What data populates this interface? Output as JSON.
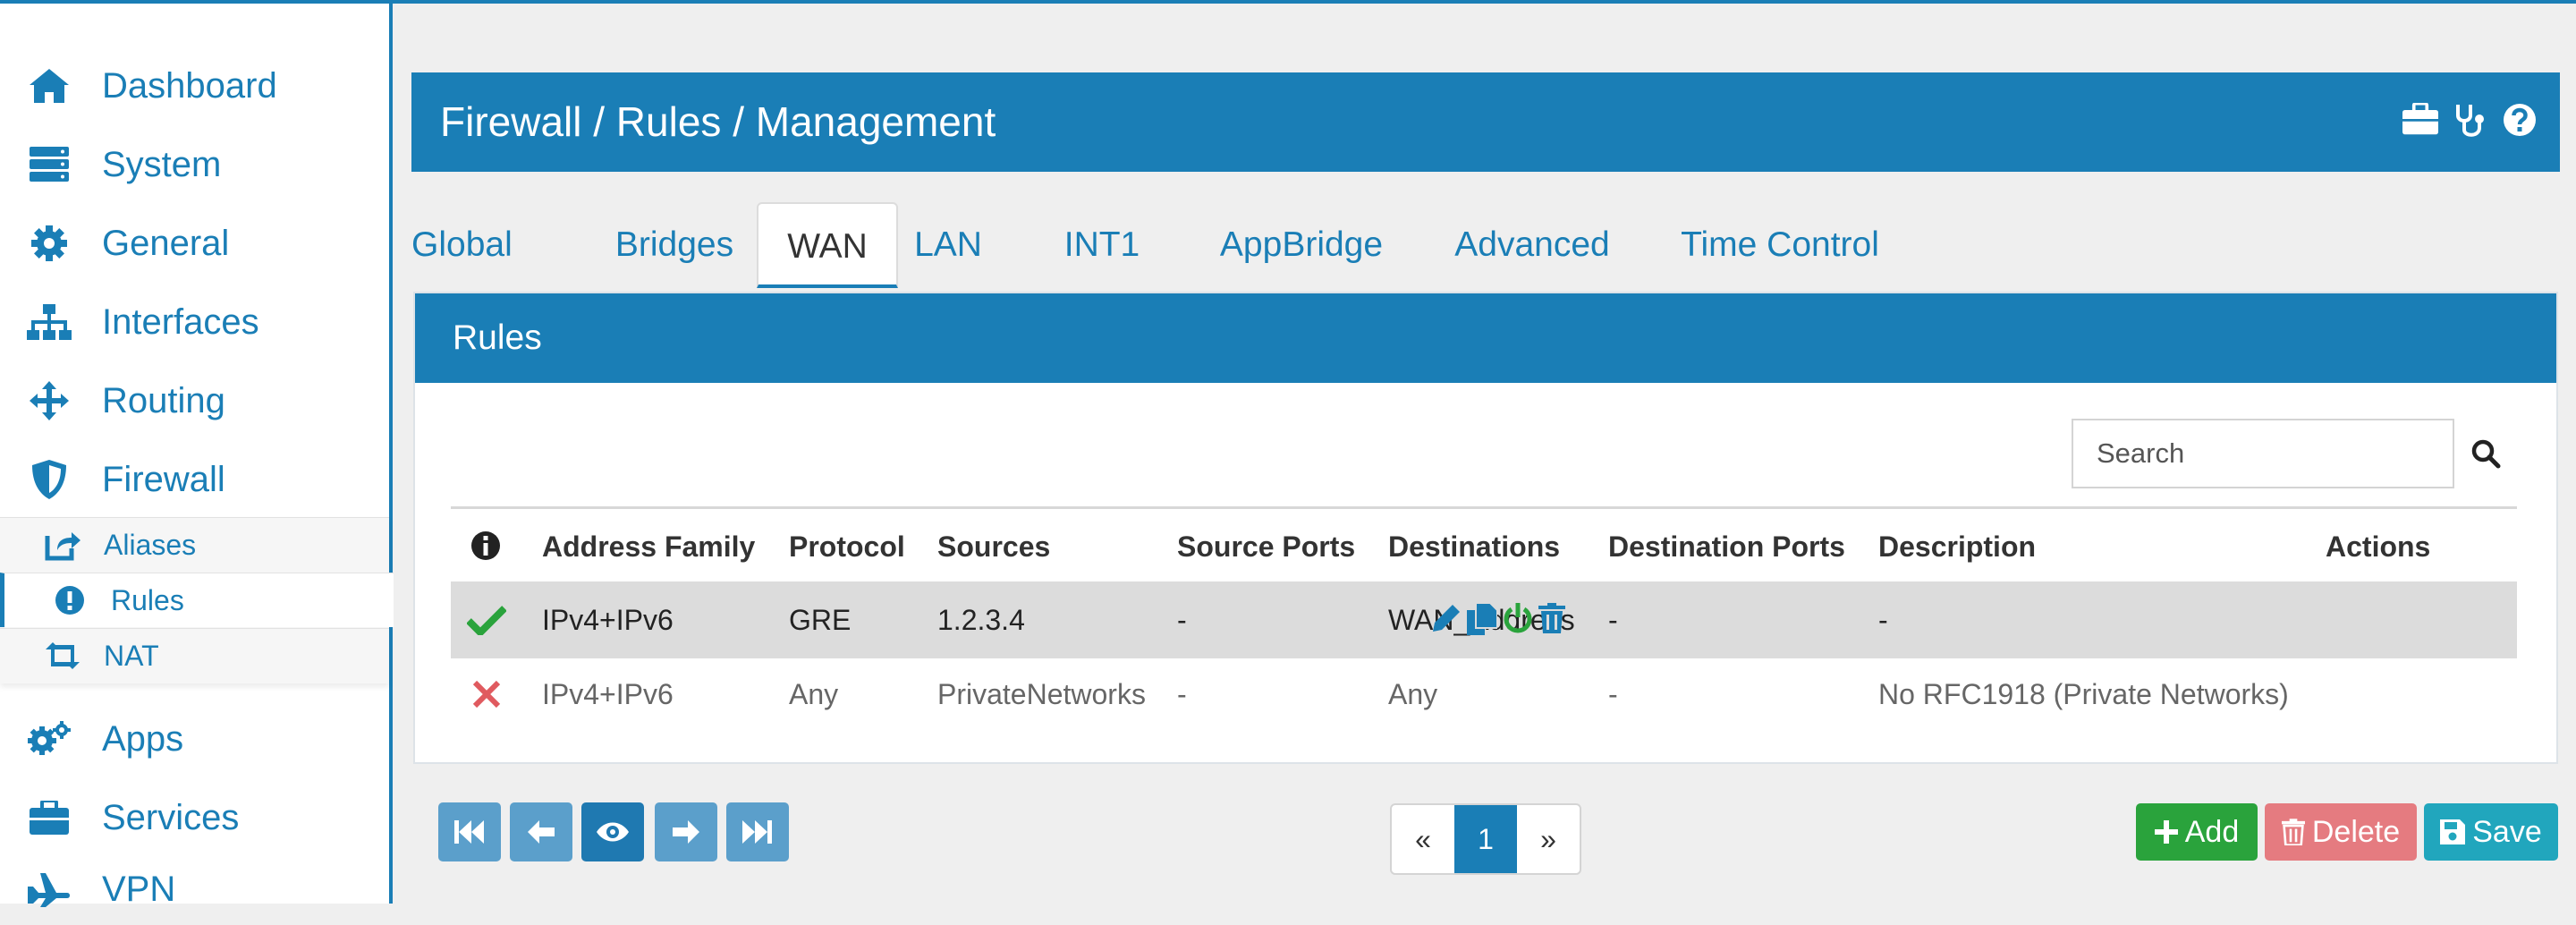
{
  "sidebar": {
    "items": [
      {
        "label": "Dashboard",
        "icon": "home-icon"
      },
      {
        "label": "System",
        "icon": "server-icon"
      },
      {
        "label": "General",
        "icon": "gear-icon"
      },
      {
        "label": "Interfaces",
        "icon": "sitemap-icon"
      },
      {
        "label": "Routing",
        "icon": "arrows-icon"
      },
      {
        "label": "Firewall",
        "icon": "shield-icon"
      },
      {
        "label": "Apps",
        "icon": "gears-icon"
      },
      {
        "label": "Services",
        "icon": "briefcase-icon"
      },
      {
        "label": "VPN",
        "icon": "plane-icon"
      }
    ],
    "firewall_sub": [
      {
        "label": "Aliases",
        "icon": "share-square-icon"
      },
      {
        "label": "Rules",
        "icon": "exclamation-circle-icon"
      },
      {
        "label": "NAT",
        "icon": "retweet-icon"
      }
    ]
  },
  "header": {
    "title": "Firewall / Rules / Management",
    "icons": [
      "briefcase-icon",
      "stethoscope-icon",
      "question-circle-icon"
    ]
  },
  "tabs": [
    {
      "label": "Global"
    },
    {
      "label": "Bridges"
    },
    {
      "label": "WAN",
      "active": true
    },
    {
      "label": "LAN"
    },
    {
      "label": "INT1"
    },
    {
      "label": "AppBridge"
    },
    {
      "label": "Advanced"
    },
    {
      "label": "Time Control"
    }
  ],
  "panel": {
    "title": "Rules"
  },
  "search": {
    "placeholder": "Search"
  },
  "table": {
    "columns": [
      "Address Family",
      "Protocol",
      "Sources",
      "Source Ports",
      "Destinations",
      "Destination Ports",
      "Description",
      "Actions"
    ],
    "rows": [
      {
        "status": "enabled",
        "family": "IPv4+IPv6",
        "protocol": "GRE",
        "sources": "1.2.3.4",
        "source_ports": "-",
        "destinations": "WAN_Address",
        "destination_ports": "-",
        "description": "-"
      },
      {
        "status": "disabled",
        "family": "IPv4+IPv6",
        "protocol": "Any",
        "sources": "PrivateNetworks",
        "source_ports": "-",
        "destinations": "Any",
        "destination_ports": "-",
        "description": "No RFC1918 (Private Networks)"
      }
    ]
  },
  "pagination": {
    "prev": "«",
    "current": "1",
    "next": "»"
  },
  "buttons": {
    "add": "Add",
    "delete": "Delete",
    "save": "Save"
  },
  "colors": {
    "accent": "#1a7eb6",
    "add": "#2aa33c",
    "delete": "#e57b80",
    "save": "#21a6bd",
    "enabled": "#2aa33c",
    "disabled": "#e05a5f"
  }
}
